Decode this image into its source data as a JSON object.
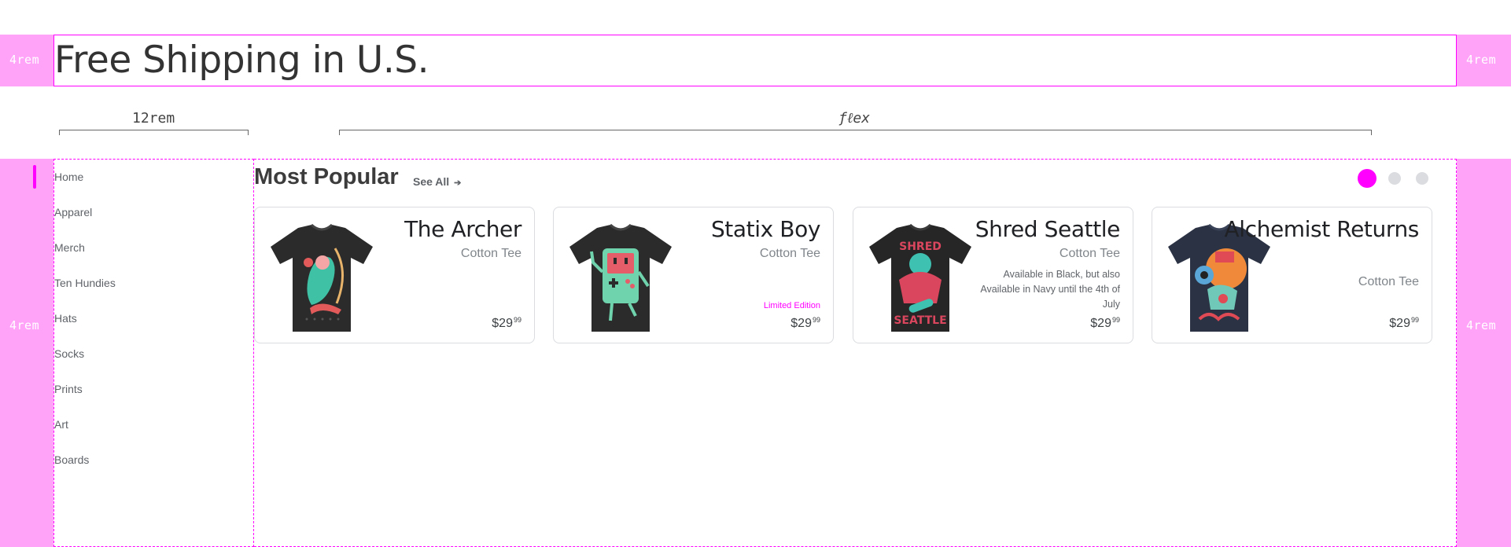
{
  "gutter_label": "4rem",
  "banner": {
    "text": "Free Shipping in U.S."
  },
  "dimensions": {
    "sidebar_width": "12rem",
    "content_width": "ƒℓex"
  },
  "sidebar": {
    "items": [
      {
        "label": "Home"
      },
      {
        "label": "Apparel"
      },
      {
        "label": "Merch"
      },
      {
        "label": "Ten Hundies"
      },
      {
        "label": "Hats"
      },
      {
        "label": "Socks"
      },
      {
        "label": "Prints"
      },
      {
        "label": "Art"
      },
      {
        "label": "Boards"
      }
    ]
  },
  "section": {
    "title": "Most Popular",
    "see_all": "See All",
    "see_all_arrow": "➔"
  },
  "pager": {
    "pages": 3,
    "active": 1
  },
  "colors": {
    "accent": "#ff00ff",
    "gutter": "#ffa3f9"
  },
  "products": [
    {
      "title": "The Archer",
      "subtitle": "Cotton Tee",
      "note": "",
      "badge": "",
      "price_dollars": "$29",
      "price_cents": "99",
      "shirt_color": "#2b2b2b",
      "graphic": "archer-graphic"
    },
    {
      "title": "Statix Boy",
      "subtitle": "Cotton Tee",
      "note": "",
      "badge": "Limited Edition",
      "price_dollars": "$29",
      "price_cents": "99",
      "shirt_color": "#2b2b2b",
      "graphic": "gameboy-graphic"
    },
    {
      "title": "Shred Seattle",
      "subtitle": "Cotton Tee",
      "note": "Available in Black, but also Available in Navy until the 4th of July",
      "badge": "",
      "price_dollars": "$29",
      "price_cents": "99",
      "shirt_color": "#262626",
      "graphic": "skater-graphic"
    },
    {
      "title": "Alchemist Returns",
      "subtitle": "Cotton Tee",
      "note": "",
      "badge": "",
      "price_dollars": "$29",
      "price_cents": "99",
      "shirt_color": "#2a3244",
      "graphic": "alchemist-graphic"
    }
  ]
}
